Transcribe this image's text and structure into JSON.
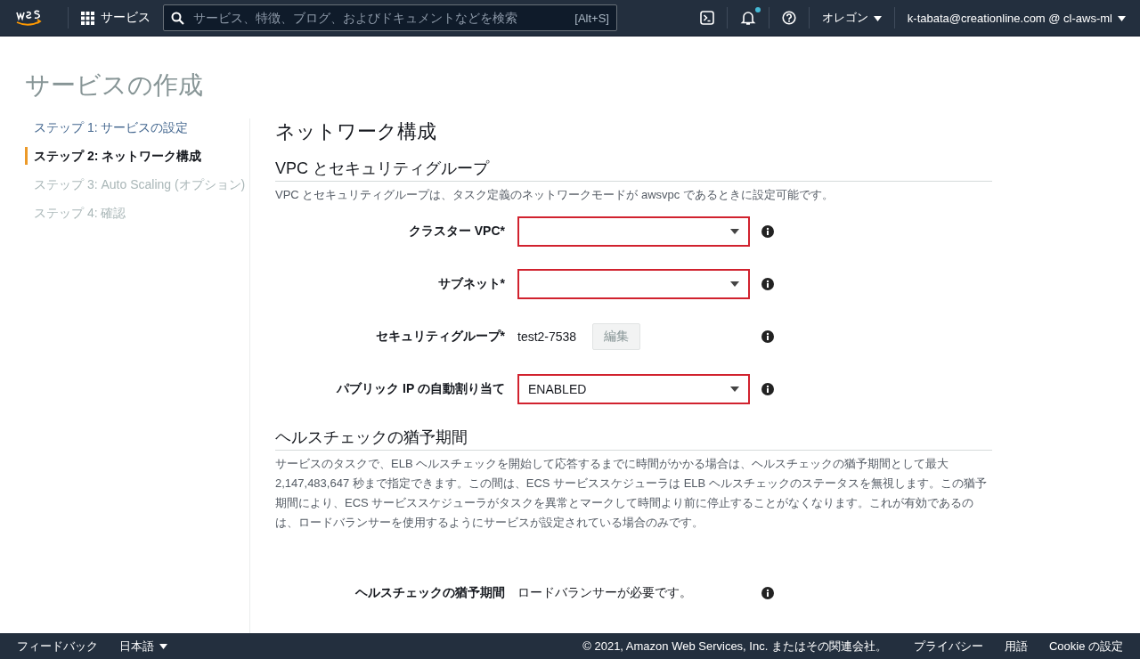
{
  "top_nav": {
    "services_label": "サービス",
    "search_placeholder": "サービス、特徴、ブログ、およびドキュメントなどを検索",
    "search_shortcut": "[Alt+S]",
    "notification_unread": true,
    "region": "オレゴン",
    "account": "k-tabata@creationline.com @ cl-aws-ml"
  },
  "page_title": "サービスの作成",
  "steps": [
    {
      "label": "ステップ 1: サービスの設定",
      "selected": false,
      "completed": true
    },
    {
      "label": "ステップ 2: ネットワーク構成",
      "selected": true,
      "completed": false
    },
    {
      "label": "ステップ 3: Auto Scaling (オプション)",
      "selected": false,
      "completed": false
    },
    {
      "label": "ステップ 4: 確認",
      "selected": false,
      "completed": false
    }
  ],
  "heading": "ネットワーク構成",
  "sections": [
    {
      "title": "VPC とセキュリティグループ",
      "description": "VPC とセキュリティグループは、タスク定義のネットワークモードが awsvpc であるときに設定可能です。",
      "fields": [
        {
          "label": "クラスター VPC*",
          "kind": "select",
          "highlighted": true
        },
        {
          "label": "サブネット*",
          "kind": "select",
          "highlighted": true
        },
        {
          "label": "セキュリティグループ*",
          "kind": "value_button",
          "value": "test2-7538",
          "button": "編集"
        },
        {
          "label": "パブリック IP の自動割り当て",
          "kind": "select",
          "value": "ENABLED",
          "highlighted": true
        }
      ]
    },
    {
      "title": "ヘルスチェックの猶予期間",
      "description": "サービスのタスクで、ELB ヘルスチェックを開始して応答するまでに時間がかかる場合は、ヘルスチェックの猶予期間として最大 2,147,483,647 秒まで指定できます。この間は、ECS サービススケジューラは ELB ヘルスチェックのステータスを無視します。この猶予期間により、ECS サービススケジューラがタスクを異常とマークして時間より前に停止することがなくなります。これが有効であるのは、ロードバランサーを使用するようにサービスが設定されている場合のみです。",
      "fields": [
        {
          "label": "ヘルスチェックの猶予期間",
          "kind": "text",
          "value": "ロードバランサーが必要です。"
        }
      ]
    }
  ],
  "footer": {
    "feedback": "フィードバック",
    "language": "日本語",
    "copyright": "© 2021, Amazon Web Services, Inc. またはその関連会社。",
    "links": [
      "プライバシー",
      "用語",
      "Cookie の設定"
    ]
  }
}
